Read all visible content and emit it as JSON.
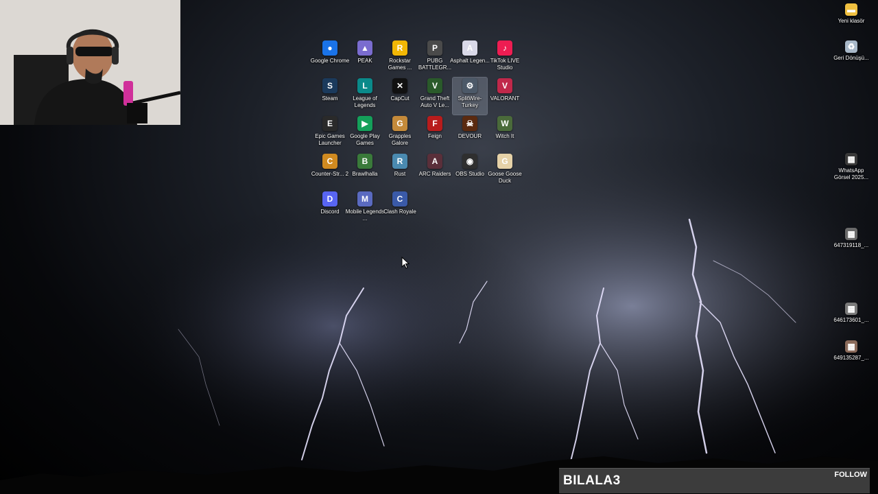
{
  "desktop": {
    "icons": [
      {
        "label": "Google Chrome",
        "glyph": "●",
        "color": "#1a73e8",
        "icon": "chrome-icon"
      },
      {
        "label": "PEAK",
        "glyph": "▲",
        "color": "#7a6ccf",
        "icon": "peak-icon"
      },
      {
        "label": "Rockstar Games ...",
        "glyph": "R",
        "color": "#f2b705",
        "icon": "rockstar-icon"
      },
      {
        "label": "PUBG BATTLEGR...",
        "glyph": "P",
        "color": "#4a4a4a",
        "icon": "pubg-icon"
      },
      {
        "label": "Asphalt Legen...",
        "glyph": "A",
        "color": "#d9d9e8",
        "icon": "asphalt-icon"
      },
      {
        "label": "TikTok LIVE Studio",
        "glyph": "♪",
        "color": "#ee1d52",
        "icon": "tiktok-icon"
      },
      {
        "label": "Steam",
        "glyph": "S",
        "color": "#1b3a5c",
        "icon": "steam-icon"
      },
      {
        "label": "League of Legends",
        "glyph": "L",
        "color": "#0a8a8a",
        "icon": "league-icon"
      },
      {
        "label": "CapCut",
        "glyph": "✕",
        "color": "#111111",
        "icon": "capcut-icon"
      },
      {
        "label": "Grand Theft Auto V Le...",
        "glyph": "V",
        "color": "#2a5a2a",
        "icon": "gta-icon"
      },
      {
        "label": "SplitWire-Turkey",
        "glyph": "⚙",
        "color": "#4c5968",
        "icon": "splitwire-icon",
        "selected": true
      },
      {
        "label": "VALORANT",
        "glyph": "V",
        "color": "#c0284a",
        "icon": "valorant-icon"
      },
      {
        "label": "Epic Games Launcher",
        "glyph": "E",
        "color": "#2a2a2a",
        "icon": "epic-icon"
      },
      {
        "label": "Google Play Games",
        "glyph": "▶",
        "color": "#14a05a",
        "icon": "play-games-icon"
      },
      {
        "label": "Grapples Galore",
        "glyph": "G",
        "color": "#c48a3a",
        "icon": "grapples-icon"
      },
      {
        "label": "Feign",
        "glyph": "F",
        "color": "#b81c1c",
        "icon": "feign-icon"
      },
      {
        "label": "DEVOUR",
        "glyph": "☠",
        "color": "#5a2a10",
        "icon": "devour-icon"
      },
      {
        "label": "Witch It",
        "glyph": "W",
        "color": "#4a6a3a",
        "icon": "witch-it-icon"
      },
      {
        "label": "Counter-Str... 2",
        "glyph": "C",
        "color": "#d08a20",
        "icon": "cs2-icon"
      },
      {
        "label": "Brawlhalla",
        "glyph": "B",
        "color": "#3a7a3a",
        "icon": "brawlhalla-icon"
      },
      {
        "label": "Rust",
        "glyph": "R",
        "color": "#4a8ab0",
        "icon": "rust-icon"
      },
      {
        "label": "ARC Raiders",
        "glyph": "A",
        "color": "#5a2f3a",
        "icon": "arc-raiders-icon"
      },
      {
        "label": "OBS Studio",
        "glyph": "◉",
        "color": "#2f2f2f",
        "icon": "obs-icon"
      },
      {
        "label": "Goose Goose Duck",
        "glyph": "G",
        "color": "#e6d2a8",
        "icon": "goose-duck-icon"
      },
      {
        "label": "Discord",
        "glyph": "D",
        "color": "#5865f2",
        "icon": "discord-icon"
      },
      {
        "label": "Mobile Legends ...",
        "glyph": "M",
        "color": "#5a6ac0",
        "icon": "mobile-legends-icon"
      },
      {
        "label": "Clash Royale",
        "glyph": "C",
        "color": "#3a5aa8",
        "icon": "clash-royale-icon"
      }
    ],
    "right_icons": [
      {
        "label": "Yeni klasör",
        "glyph": "▬",
        "color": "#f0c040",
        "icon": "folder-icon"
      },
      {
        "label": "Geri Dönüşü...",
        "glyph": "♻",
        "color": "#a8b8c8",
        "icon": "recycle-bin-icon"
      },
      {
        "label": "WhatsApp Görsel 2025...",
        "glyph": "▦",
        "color": "#3a3a3a",
        "icon": "image-file-icon"
      },
      {
        "label": "647319118_...",
        "glyph": "▦",
        "color": "#6a6a6a",
        "icon": "image-file-icon"
      },
      {
        "label": "646173601_...",
        "glyph": "▦",
        "color": "#7a7a7a",
        "icon": "image-file-icon"
      },
      {
        "label": "649135287_...",
        "glyph": "▦",
        "color": "#8a6a5a",
        "icon": "image-file-icon"
      }
    ]
  },
  "overlay": {
    "name": "BILALA3",
    "follow": "FOLLOW"
  }
}
